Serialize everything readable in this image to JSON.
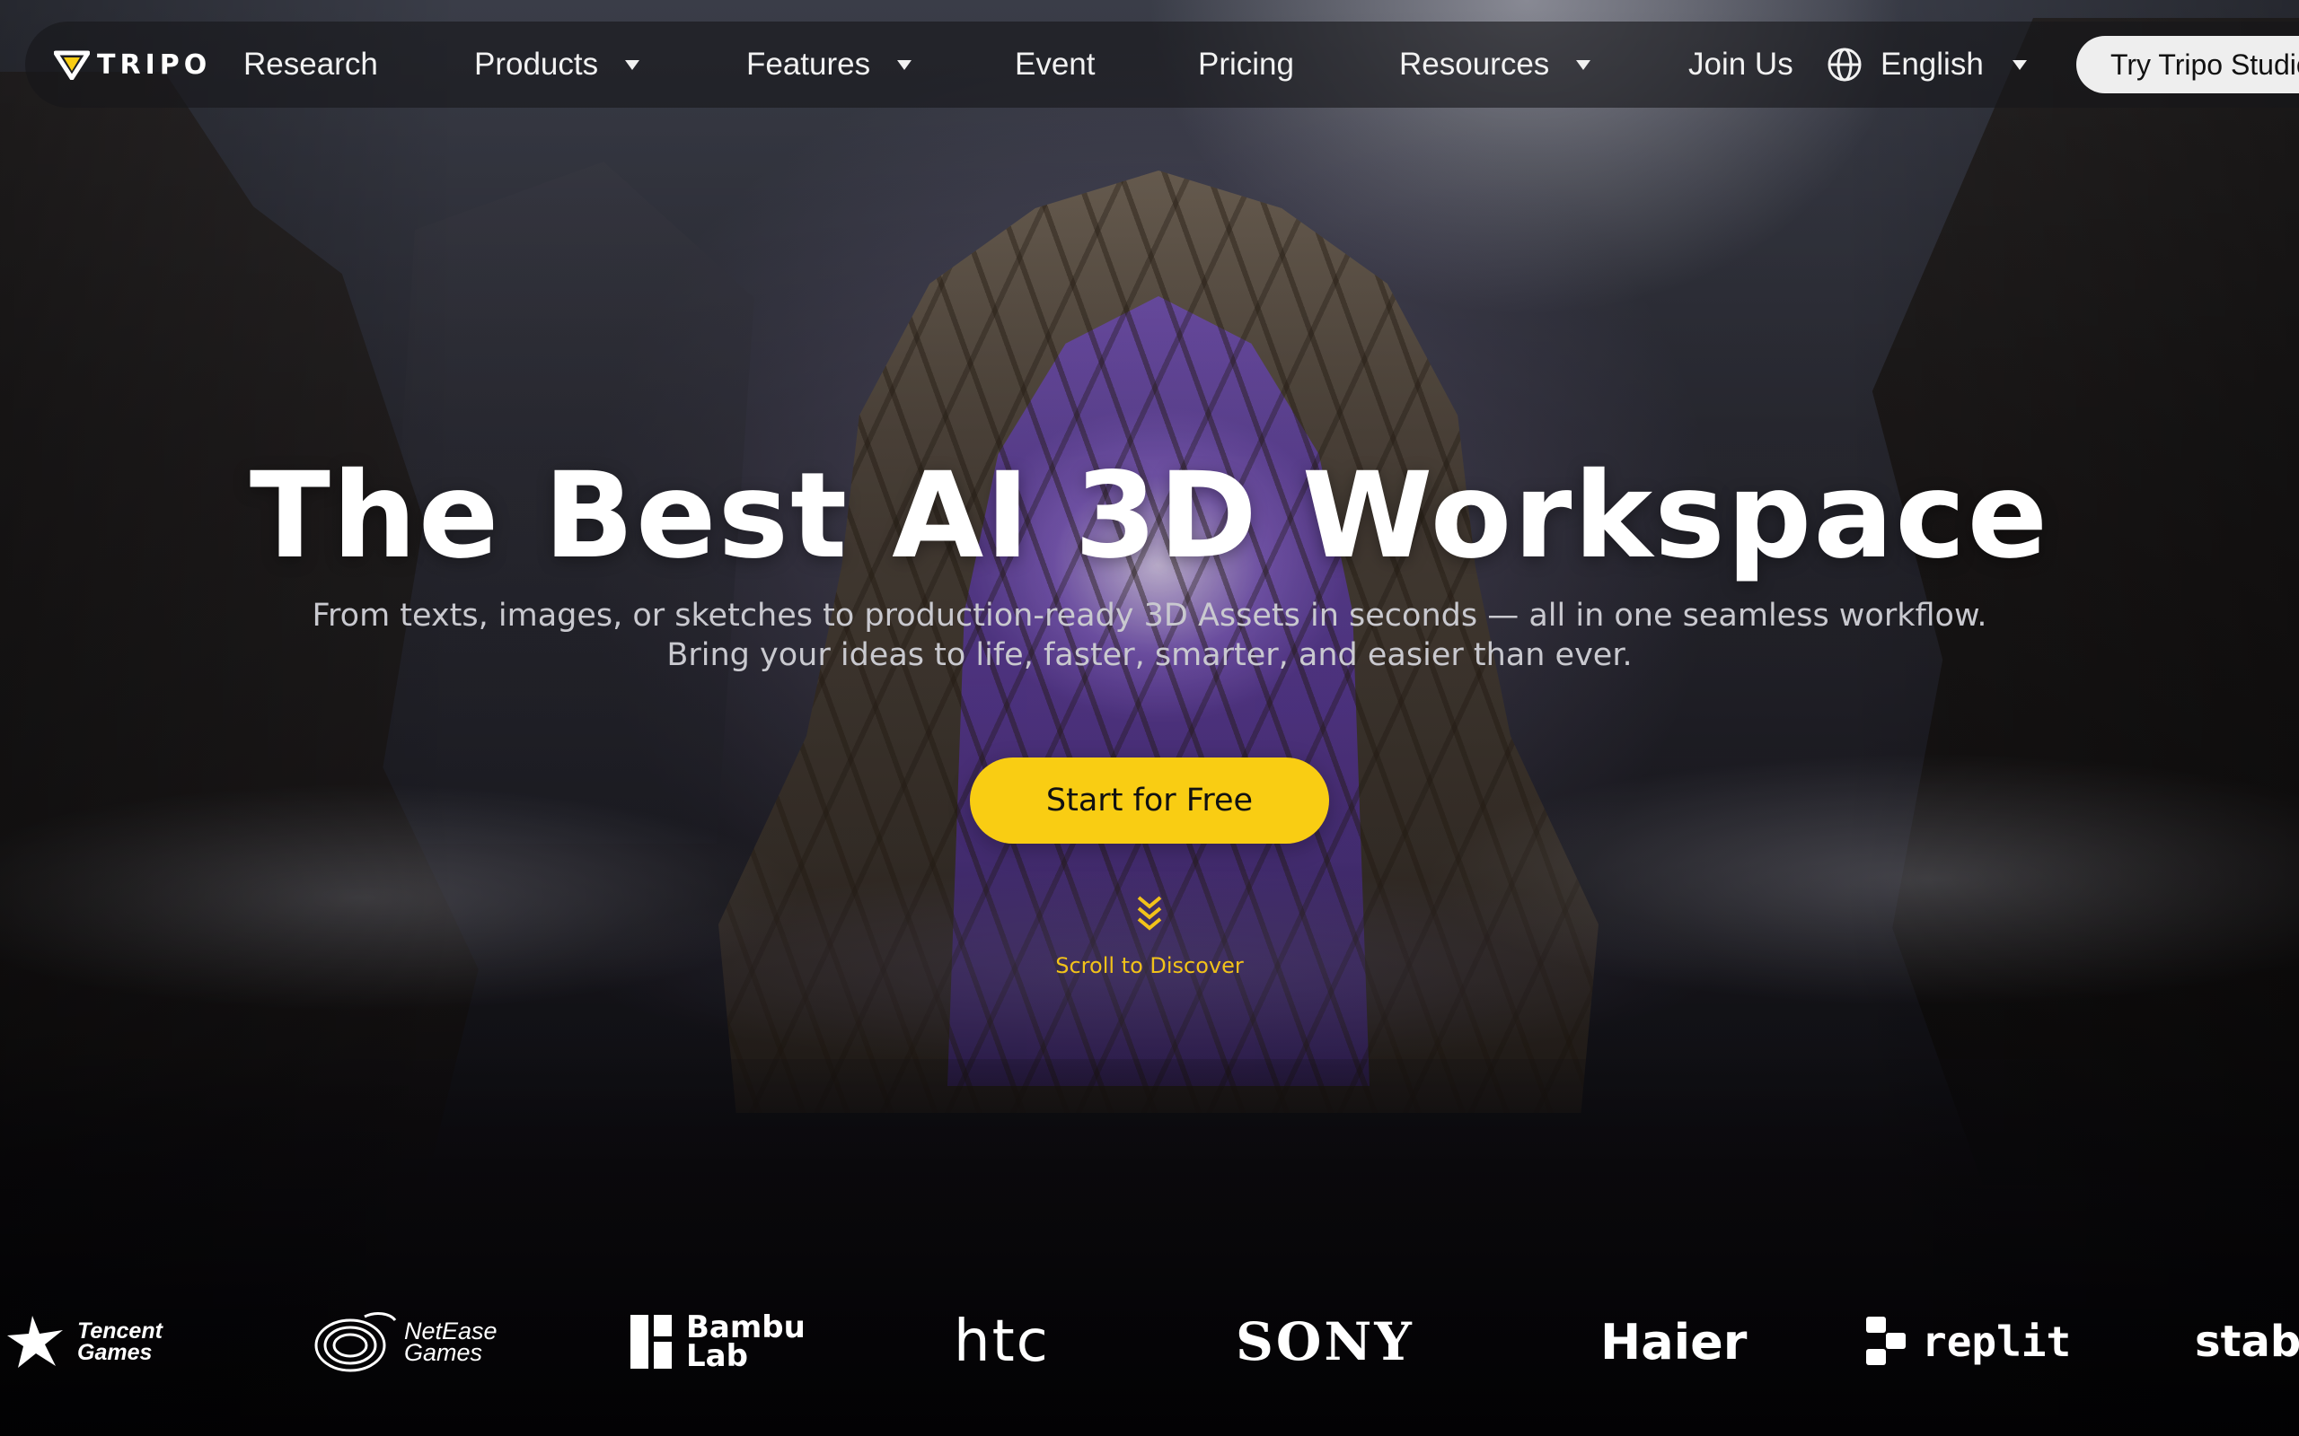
{
  "brand": {
    "logo_text": "TRIPO",
    "accent": "#f9cd13"
  },
  "nav": {
    "items": [
      {
        "label": "Research",
        "dropdown": false
      },
      {
        "label": "Products",
        "dropdown": true
      },
      {
        "label": "Features",
        "dropdown": true
      },
      {
        "label": "Event",
        "dropdown": false
      },
      {
        "label": "Pricing",
        "dropdown": false
      },
      {
        "label": "Resources",
        "dropdown": true
      },
      {
        "label": "Join Us",
        "dropdown": false
      }
    ],
    "language": {
      "label": "English",
      "icon": "globe-icon"
    },
    "cta_label": "Try Tripo Studio"
  },
  "hero": {
    "title": "The Best AI 3D Workspace",
    "subtitle_line1": "From texts, images, or sketches to production-ready 3D Assets in seconds — all in one seamless workflow.",
    "subtitle_line2": "Bring your ideas to life, faster, smarter, and easier than ever.",
    "cta_label": "Start for Free",
    "scroll_label": "Scroll to Discover",
    "scroll_icon": "chevrons-down-icon"
  },
  "partners": {
    "tencent": {
      "line1": "Tencent",
      "line2": "Games"
    },
    "netease": {
      "line1": "NetEase",
      "line2": "Games"
    },
    "bambu": {
      "line1": "Bambu",
      "line2": "Lab"
    },
    "htc": "htc",
    "sony": "SONY",
    "haier": "Haier",
    "replit": "replit",
    "stability": "stabi"
  }
}
